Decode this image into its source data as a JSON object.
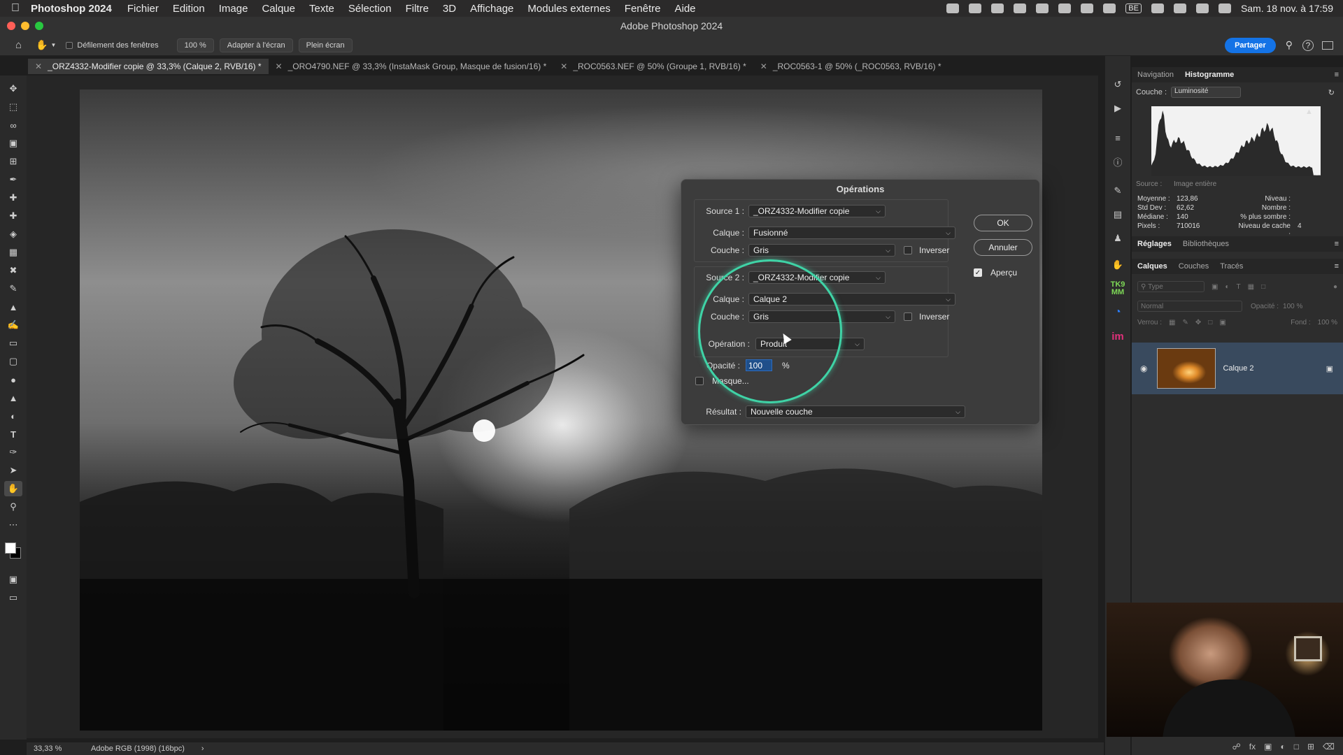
{
  "menubar": {
    "app_name": "Photoshop 2024",
    "items": [
      "Fichier",
      "Edition",
      "Image",
      "Calque",
      "Texte",
      "Sélection",
      "Filtre",
      "3D",
      "Affichage",
      "Modules externes",
      "Fenêtre",
      "Aide"
    ],
    "clock": "Sam. 18 nov. à 17:59",
    "input_source": "BE"
  },
  "window": {
    "title": "Adobe Photoshop 2024"
  },
  "options_bar": {
    "scroll_all_windows_label": "Défilement des fenêtres",
    "zoom_value": "100 %",
    "fit_screen_label": "Adapter à l'écran",
    "full_screen_label": "Plein écran",
    "share_label": "Partager"
  },
  "tabs": [
    {
      "label": "_ORZ4332-Modifier copie @ 33,3% (Calque 2, RVB/16) *",
      "active": true
    },
    {
      "label": "_ORO4790.NEF @ 33,3% (InstaMask Group, Masque de fusion/16) *",
      "active": false
    },
    {
      "label": "_ROC0563.NEF @ 50% (Groupe 1, RVB/16) *",
      "active": false
    },
    {
      "label": "_ROC0563-1 @ 50% (_ROC0563, RVB/16) *",
      "active": false
    }
  ],
  "status_bar": {
    "zoom": "33,33 %",
    "profile": "Adobe RGB (1998) (16bpc)"
  },
  "dialog": {
    "title": "Opérations",
    "source1": {
      "label": "Source 1 :",
      "value": "_ORZ4332-Modifier copie",
      "layer_label": "Calque :",
      "layer_value": "Fusionné",
      "channel_label": "Couche :",
      "channel_value": "Gris",
      "invert_label": "Inverser"
    },
    "source2": {
      "label": "Source 2 :",
      "value": "_ORZ4332-Modifier copie",
      "layer_label": "Calque :",
      "layer_value": "Calque 2",
      "channel_label": "Couche :",
      "channel_value": "Gris",
      "invert_label": "Inverser"
    },
    "operation_label": "Opération :",
    "operation_value": "Produit",
    "opacity_label": "Opacité :",
    "opacity_value": "100",
    "opacity_unit": "%",
    "mask_label": "Masque...",
    "result_label": "Résultat :",
    "result_value": "Nouvelle couche",
    "ok_label": "OK",
    "cancel_label": "Annuler",
    "preview_label": "Aperçu",
    "preview_checked": true
  },
  "histogram_panel": {
    "tabs": [
      "Navigation",
      "Histogramme"
    ],
    "active_tab": "Histogramme",
    "channel_label": "Couche :",
    "channel_value": "Luminosité",
    "source_label": "Source :",
    "source_value": "Image entière",
    "stats": {
      "mean_label": "Moyenne :",
      "mean": "123,86",
      "stddev_label": "Std Dev :",
      "stddev": "62,62",
      "median_label": "Médiane :",
      "median": "140",
      "pixels_label": "Pixels :",
      "pixels": "710016",
      "level_label": "Niveau :",
      "level": "",
      "count_label": "Nombre :",
      "count": "",
      "percentile_label": "% plus sombre :",
      "percentile": "",
      "cache_label": "Niveau de cache :",
      "cache": "4"
    }
  },
  "adjust_panel": {
    "tabs": [
      "Réglages",
      "Bibliothèques"
    ]
  },
  "layers_panel": {
    "tabs": [
      "Calques",
      "Couches",
      "Tracés"
    ],
    "filter_placeholder": "Type",
    "blend_mode": "Normal",
    "opacity_label": "Opacité :",
    "opacity_value": "100 %",
    "lock_label": "Verrou :",
    "fill_label": "Fond :",
    "fill_value": "100 %",
    "layers": [
      {
        "name": "Calque 2",
        "visible": true,
        "locked": true
      }
    ]
  },
  "colors": {
    "accent": "#1473e6",
    "highlight_circle": "#3fd3a6",
    "selected_layer": "#394a5e"
  }
}
